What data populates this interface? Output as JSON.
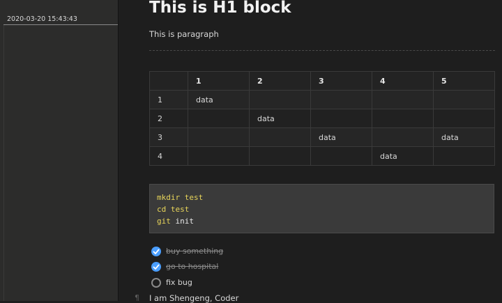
{
  "sidebar": {
    "files": [
      {
        "label": "2020-03-20 15:43:43"
      }
    ]
  },
  "editor": {
    "h1": "This is H1 block",
    "paragraph": "This is paragraph",
    "table": {
      "headers": [
        "",
        "1",
        "2",
        "3",
        "4",
        "5"
      ],
      "rows": [
        [
          "1",
          "data",
          "",
          "",
          "",
          ""
        ],
        [
          "2",
          "",
          "data",
          "",
          "",
          ""
        ],
        [
          "3",
          "",
          "",
          "data",
          "",
          "data"
        ],
        [
          "4",
          "",
          "",
          "",
          "data",
          ""
        ]
      ]
    },
    "code": [
      {
        "cmd": "mkdir",
        "arg": "test"
      },
      {
        "cmd": "cd",
        "arg": "test"
      },
      {
        "cmd": "git",
        "arg": "init"
      }
    ],
    "tasks": [
      {
        "label": "buy something",
        "checked": true
      },
      {
        "label": "go to hospital",
        "checked": true
      },
      {
        "label": "fix bug",
        "checked": false
      }
    ],
    "pilcrow": "¶",
    "last_paragraph": "I am Shengeng,  Coder"
  }
}
